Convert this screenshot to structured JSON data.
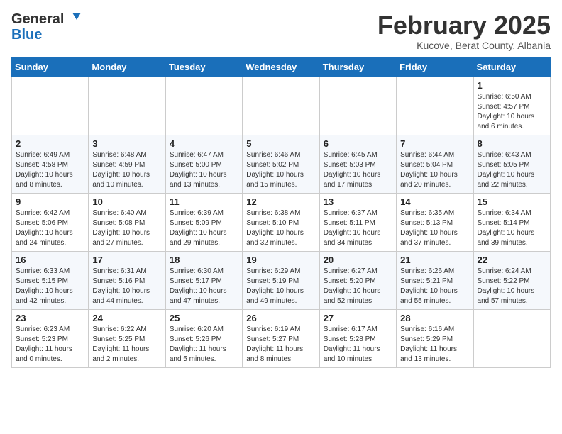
{
  "logo": {
    "general": "General",
    "blue": "Blue"
  },
  "header": {
    "month": "February 2025",
    "location": "Kucove, Berat County, Albania"
  },
  "weekdays": [
    "Sunday",
    "Monday",
    "Tuesday",
    "Wednesday",
    "Thursday",
    "Friday",
    "Saturday"
  ],
  "weeks": [
    [
      null,
      null,
      null,
      null,
      null,
      null,
      {
        "day": "1",
        "sunrise": "6:50 AM",
        "sunset": "4:57 PM",
        "daylight": "10 hours and 6 minutes."
      }
    ],
    [
      {
        "day": "2",
        "sunrise": "6:49 AM",
        "sunset": "4:58 PM",
        "daylight": "10 hours and 8 minutes."
      },
      {
        "day": "3",
        "sunrise": "6:48 AM",
        "sunset": "4:59 PM",
        "daylight": "10 hours and 10 minutes."
      },
      {
        "day": "4",
        "sunrise": "6:47 AM",
        "sunset": "5:00 PM",
        "daylight": "10 hours and 13 minutes."
      },
      {
        "day": "5",
        "sunrise": "6:46 AM",
        "sunset": "5:02 PM",
        "daylight": "10 hours and 15 minutes."
      },
      {
        "day": "6",
        "sunrise": "6:45 AM",
        "sunset": "5:03 PM",
        "daylight": "10 hours and 17 minutes."
      },
      {
        "day": "7",
        "sunrise": "6:44 AM",
        "sunset": "5:04 PM",
        "daylight": "10 hours and 20 minutes."
      },
      {
        "day": "8",
        "sunrise": "6:43 AM",
        "sunset": "5:05 PM",
        "daylight": "10 hours and 22 minutes."
      }
    ],
    [
      {
        "day": "9",
        "sunrise": "6:42 AM",
        "sunset": "5:06 PM",
        "daylight": "10 hours and 24 minutes."
      },
      {
        "day": "10",
        "sunrise": "6:40 AM",
        "sunset": "5:08 PM",
        "daylight": "10 hours and 27 minutes."
      },
      {
        "day": "11",
        "sunrise": "6:39 AM",
        "sunset": "5:09 PM",
        "daylight": "10 hours and 29 minutes."
      },
      {
        "day": "12",
        "sunrise": "6:38 AM",
        "sunset": "5:10 PM",
        "daylight": "10 hours and 32 minutes."
      },
      {
        "day": "13",
        "sunrise": "6:37 AM",
        "sunset": "5:11 PM",
        "daylight": "10 hours and 34 minutes."
      },
      {
        "day": "14",
        "sunrise": "6:35 AM",
        "sunset": "5:13 PM",
        "daylight": "10 hours and 37 minutes."
      },
      {
        "day": "15",
        "sunrise": "6:34 AM",
        "sunset": "5:14 PM",
        "daylight": "10 hours and 39 minutes."
      }
    ],
    [
      {
        "day": "16",
        "sunrise": "6:33 AM",
        "sunset": "5:15 PM",
        "daylight": "10 hours and 42 minutes."
      },
      {
        "day": "17",
        "sunrise": "6:31 AM",
        "sunset": "5:16 PM",
        "daylight": "10 hours and 44 minutes."
      },
      {
        "day": "18",
        "sunrise": "6:30 AM",
        "sunset": "5:17 PM",
        "daylight": "10 hours and 47 minutes."
      },
      {
        "day": "19",
        "sunrise": "6:29 AM",
        "sunset": "5:19 PM",
        "daylight": "10 hours and 49 minutes."
      },
      {
        "day": "20",
        "sunrise": "6:27 AM",
        "sunset": "5:20 PM",
        "daylight": "10 hours and 52 minutes."
      },
      {
        "day": "21",
        "sunrise": "6:26 AM",
        "sunset": "5:21 PM",
        "daylight": "10 hours and 55 minutes."
      },
      {
        "day": "22",
        "sunrise": "6:24 AM",
        "sunset": "5:22 PM",
        "daylight": "10 hours and 57 minutes."
      }
    ],
    [
      {
        "day": "23",
        "sunrise": "6:23 AM",
        "sunset": "5:23 PM",
        "daylight": "11 hours and 0 minutes."
      },
      {
        "day": "24",
        "sunrise": "6:22 AM",
        "sunset": "5:25 PM",
        "daylight": "11 hours and 2 minutes."
      },
      {
        "day": "25",
        "sunrise": "6:20 AM",
        "sunset": "5:26 PM",
        "daylight": "11 hours and 5 minutes."
      },
      {
        "day": "26",
        "sunrise": "6:19 AM",
        "sunset": "5:27 PM",
        "daylight": "11 hours and 8 minutes."
      },
      {
        "day": "27",
        "sunrise": "6:17 AM",
        "sunset": "5:28 PM",
        "daylight": "11 hours and 10 minutes."
      },
      {
        "day": "28",
        "sunrise": "6:16 AM",
        "sunset": "5:29 PM",
        "daylight": "11 hours and 13 minutes."
      },
      null
    ]
  ]
}
